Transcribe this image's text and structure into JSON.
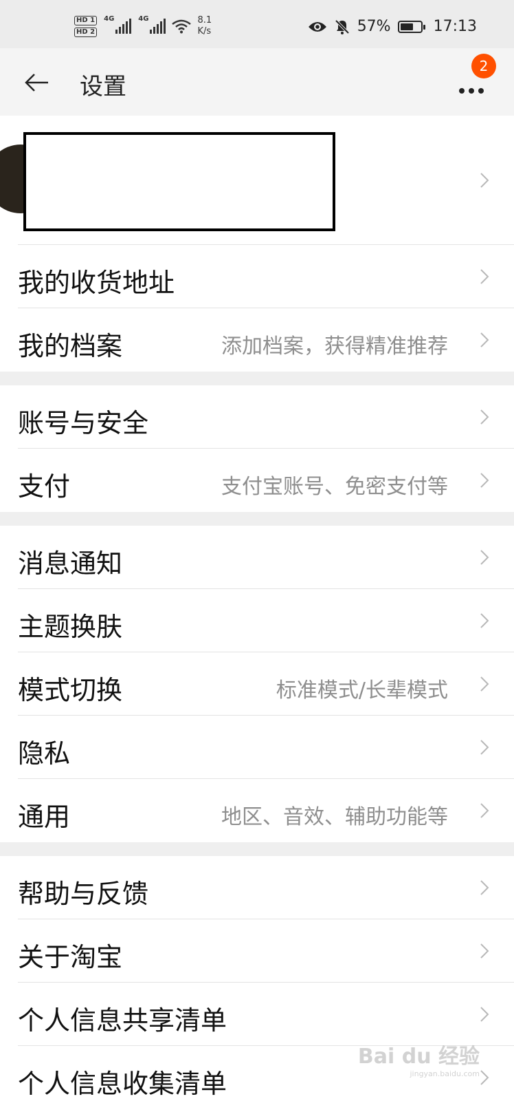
{
  "status_bar": {
    "sim1": "HD 1",
    "sim2": "HD 2",
    "net1": "4G",
    "net2": "4G",
    "speed_value": "8.1",
    "speed_unit": "K/s",
    "battery_percent": "57%",
    "time": "17:13",
    "icons": [
      "eye-icon",
      "bell-muted-icon",
      "battery-icon",
      "wifi-icon",
      "signal-icon"
    ]
  },
  "header": {
    "title": "设置",
    "back_icon": "arrow-left-icon",
    "more_icon": "more-dots-icon",
    "badge_count": "2",
    "badge_color": "#ff5000"
  },
  "groups": [
    {
      "rows": [
        {
          "label": "我的收货地址",
          "sub": ""
        },
        {
          "label": "我的档案",
          "sub": "添加档案，获得精准推荐"
        }
      ]
    },
    {
      "rows": [
        {
          "label": "账号与安全",
          "sub": ""
        },
        {
          "label": "支付",
          "sub": "支付宝账号、免密支付等"
        }
      ]
    },
    {
      "rows": [
        {
          "label": "消息通知",
          "sub": ""
        },
        {
          "label": "主题换肤",
          "sub": ""
        },
        {
          "label": "模式切换",
          "sub": "标准模式/长辈模式"
        },
        {
          "label": "隐私",
          "sub": ""
        },
        {
          "label": "通用",
          "sub": "地区、音效、辅助功能等"
        }
      ]
    },
    {
      "rows": [
        {
          "label": "帮助与反馈",
          "sub": ""
        },
        {
          "label": "关于淘宝",
          "sub": ""
        },
        {
          "label": "个人信息共享清单",
          "sub": ""
        },
        {
          "label": "个人信息收集清单",
          "sub": ""
        }
      ]
    }
  ],
  "watermark": {
    "main": "Bai du 经验",
    "sub": "jingyan.baidu.com"
  }
}
